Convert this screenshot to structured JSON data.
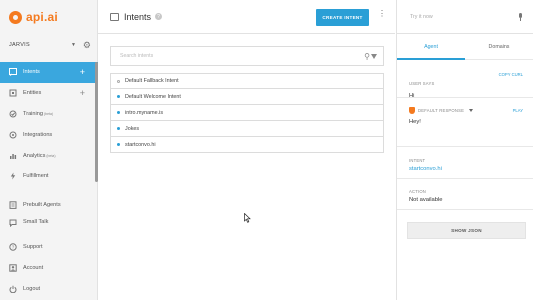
{
  "brand": {
    "name": "api.ai",
    "color": "#f47a1f"
  },
  "agent": {
    "name": "JARVIS"
  },
  "sidebar": {
    "items": [
      {
        "label": "Intents",
        "active": true,
        "plus": "+"
      },
      {
        "label": "Entities",
        "plus": "+"
      },
      {
        "label": "Training",
        "sup": "(beta)"
      },
      {
        "label": "Integrations"
      },
      {
        "label": "Analytics",
        "sup": "(beta)"
      },
      {
        "label": "Fulfillment"
      },
      {
        "label": "Prebuilt Agents"
      },
      {
        "label": "Small Talk"
      },
      {
        "label": "Support"
      },
      {
        "label": "Account"
      },
      {
        "label": "Logout"
      }
    ]
  },
  "header": {
    "title": "Intents",
    "help": "?",
    "create_label": "CREATE INTENT",
    "more": "⋮"
  },
  "search": {
    "placeholder": "Search intents"
  },
  "intents": [
    {
      "name": "Default Fallback Intent",
      "fallback": true
    },
    {
      "name": "Default Welcome Intent"
    },
    {
      "name": "intro.myname.is"
    },
    {
      "name": "Jokes"
    },
    {
      "name": "startconvo.hi"
    }
  ],
  "right_panel": {
    "try_placeholder": "Try it now",
    "tabs": [
      "Agent",
      "Domains"
    ],
    "user_says_label": "USER SAYS",
    "copy_curl": "COPY CURL",
    "user_says_value": "Hi",
    "default_response_label": "DEFAULT RESPONSE",
    "play": "PLAY",
    "default_response_value": "Hey!",
    "intent_label": "INTENT",
    "intent_value": "startconvo.hi",
    "action_label": "ACTION",
    "action_value": "Not available",
    "show_json": "SHOW JSON"
  },
  "colors": {
    "accent": "#2a9fd6",
    "active_nav": "#3aa7de"
  }
}
